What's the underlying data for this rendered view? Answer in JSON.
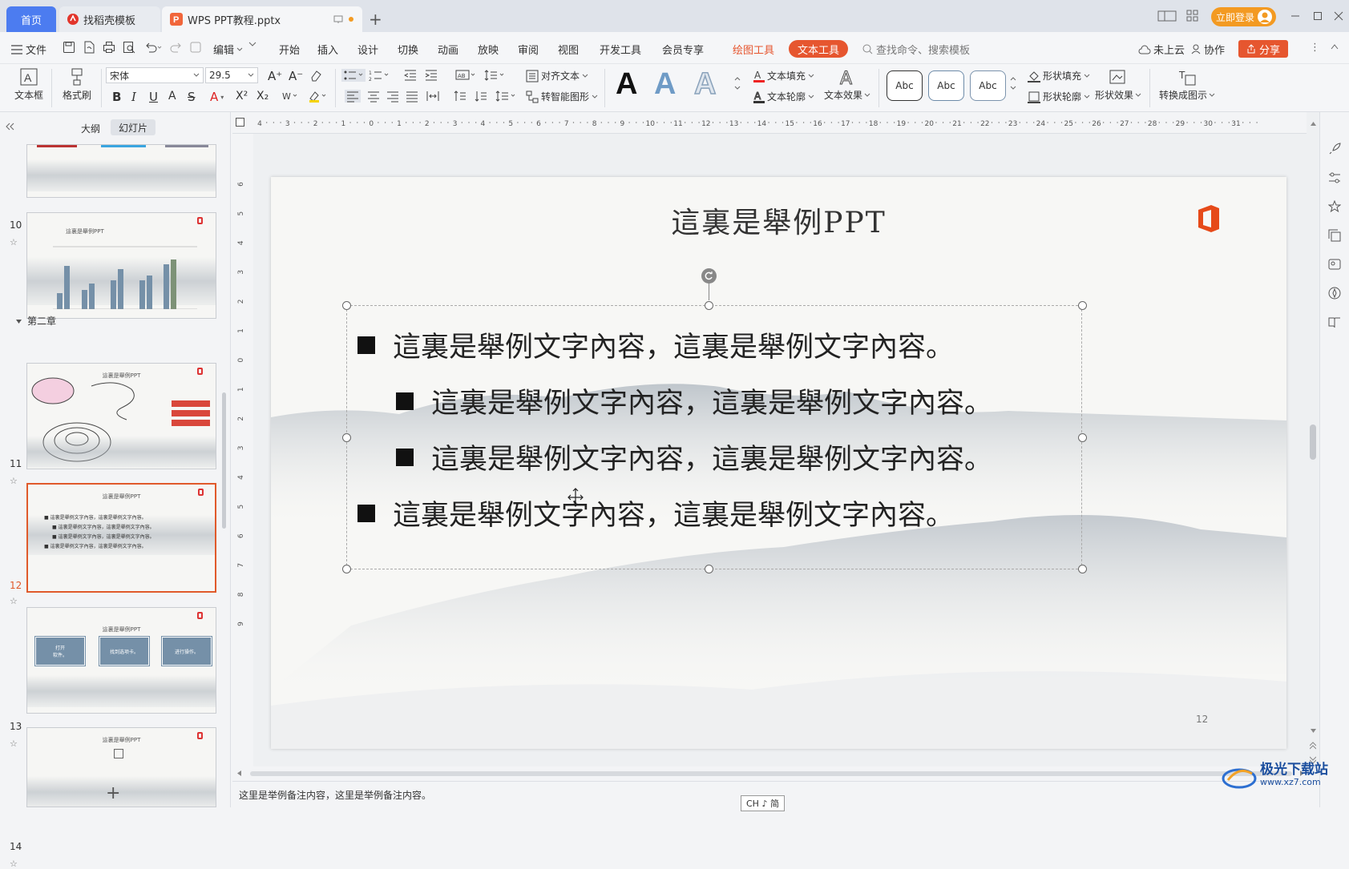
{
  "titlebar": {
    "tabs": [
      {
        "label": "首页"
      },
      {
        "label": "找稻壳模板"
      },
      {
        "label": "WPS PPT教程.pptx"
      }
    ],
    "new_tab": "+",
    "login_label": "立即登录"
  },
  "menubar": {
    "file_label": "文件",
    "edit_label": "编辑",
    "tabs": [
      "开始",
      "插入",
      "设计",
      "切换",
      "动画",
      "放映",
      "审阅",
      "视图",
      "开发工具",
      "会员专享"
    ],
    "drawing_tools": "绘图工具",
    "text_tools": "文本工具",
    "search_placeholder": "查找命令、搜索模板",
    "cloud_label": "未上云",
    "collab_label": "协作",
    "share_label": "分享"
  },
  "ribbon": {
    "textbox_label": "文本框",
    "format_painter_label": "格式刷",
    "font_name": "宋体",
    "font_size": "29.5",
    "align_text_label": "对齐文本",
    "smartart_label": "转智能图形",
    "text_fill_label": "文本填充",
    "text_outline_label": "文本轮廓",
    "text_effect_label": "文本效果",
    "shape_styles": [
      "Abc",
      "Abc",
      "Abc"
    ],
    "shape_fill_label": "形状填充",
    "shape_outline_label": "形状轮廓",
    "shape_effect_label": "形状效果",
    "convert_label": "转换成图示",
    "wordart_glyph": "A"
  },
  "left_panel": {
    "tab_outline": "大纲",
    "tab_slides": "幻灯片",
    "section_label": "第二章",
    "thumb_title": "這裏是舉例PPT",
    "slides": [
      {
        "num": "10"
      },
      {
        "num": "11"
      },
      {
        "num": "12"
      },
      {
        "num": "13",
        "boxes": [
          "打开\n软件。",
          "找到选项卡。",
          "进行操作。"
        ]
      },
      {
        "num": "14"
      }
    ],
    "add_label": "+"
  },
  "slide": {
    "title": "這裏是舉例PPT",
    "bullets": [
      {
        "level": 1,
        "text": "這裏是舉例文字內容，這裏是舉例文字內容。"
      },
      {
        "level": 2,
        "text": "這裏是舉例文字內容，這裏是舉例文字內容。"
      },
      {
        "level": 2,
        "text": "這裏是舉例文字內容，這裏是舉例文字內容。"
      },
      {
        "level": 1,
        "text": "這裏是舉例文字內容，這裏是舉例文字內容。"
      }
    ],
    "page_number": "12"
  },
  "notes": {
    "text": "这里是举例备注内容，这里是举例备注内容。"
  },
  "ime": {
    "label": "CH ♪ 简"
  },
  "watermark": {
    "text": "极光下载站",
    "url": "www.xz7.com"
  },
  "colors": {
    "accent_orange": "#e6562f",
    "home_tab_blue": "#4c7cf0",
    "login_orange": "#f39a22",
    "selected_thumb": "#e05a2b"
  }
}
